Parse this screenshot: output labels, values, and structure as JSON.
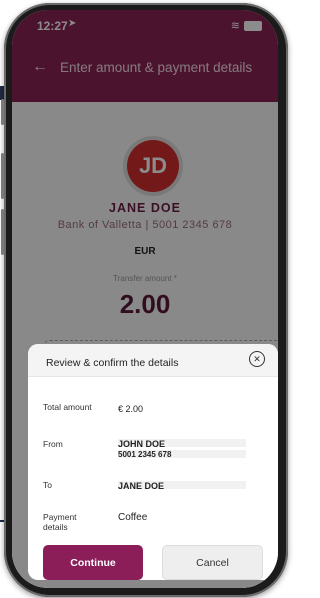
{
  "status_bar": {
    "time": "12:27",
    "location_icon": "location-arrow-icon",
    "wifi_icon": "wifi-icon",
    "battery_icon": "battery-icon"
  },
  "header": {
    "back_icon": "arrow-left-icon",
    "title": "Enter amount & payment details"
  },
  "payee": {
    "initials": "JD",
    "name": "JANE DOE",
    "bank": "Bank of Valletta | 5001 2345 678"
  },
  "currency": "EUR",
  "transfer": {
    "label": "Transfer amount *",
    "amount": "2.00"
  },
  "review": {
    "title": "Review & confirm the details",
    "close_icon": "close-circle-icon",
    "total_label": "Total amount",
    "total_value": "€ 2.00",
    "from_label": "From",
    "from_name": "JOHN DOE",
    "from_account": "5001 2345 678",
    "to_label": "To",
    "to_name": "JANE DOE",
    "payment_label_line1": "Payment",
    "payment_label_line2": "details",
    "payment_value": "Coffee",
    "continue_label": "Continue",
    "cancel_label": "Cancel"
  },
  "colors": {
    "brand": "#8a2456",
    "avatar": "#d12f2f",
    "continue_button": "#8b1e59"
  }
}
